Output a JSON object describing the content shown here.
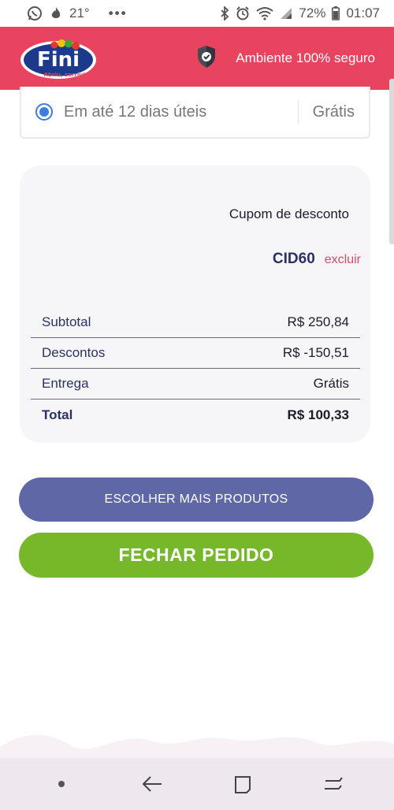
{
  "status_bar": {
    "temperature": "21°",
    "battery": "72%",
    "time": "01:07"
  },
  "header": {
    "logo_text": "Fini",
    "logo_tagline": "Abriu, sorriu!",
    "secure_text": "Ambiente 100% seguro"
  },
  "delivery": {
    "option_label": "Em até 12 dias úteis",
    "option_price": "Grátis",
    "selected": true
  },
  "summary": {
    "coupon_title": "Cupom de desconto",
    "coupon_code": "CID60",
    "coupon_remove": "excluir",
    "rows": [
      {
        "label": "Subtotal",
        "value": "R$ 250,84"
      },
      {
        "label": "Descontos",
        "value": "R$ -150,51"
      },
      {
        "label": "Entrega",
        "value": "Grátis"
      },
      {
        "label": "Total",
        "value": "R$ 100,33"
      }
    ]
  },
  "actions": {
    "more_products": "ESCOLHER MAIS PRODUTOS",
    "checkout": "FECHAR PEDIDO"
  },
  "colors": {
    "header": "#e8445f",
    "more_button": "#5f67a6",
    "checkout_button": "#77b82a",
    "coupon_code": "#2a3163",
    "remove_link": "#d94b6a"
  }
}
